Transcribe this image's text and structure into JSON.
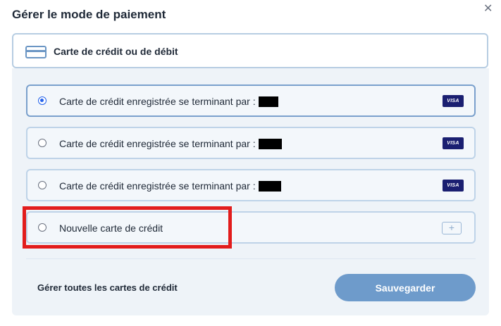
{
  "dialog": {
    "title": "Gérer le mode de paiement",
    "close_icon": "close-icon"
  },
  "method": {
    "icon": "credit-card-icon",
    "label": "Carte de crédit ou de débit"
  },
  "options": [
    {
      "label": "Carte de crédit enregistrée se terminant par :",
      "selected": true,
      "brand": "VISA"
    },
    {
      "label": "Carte de crédit enregistrée se terminant par :",
      "selected": false,
      "brand": "VISA"
    },
    {
      "label": "Carte de crédit enregistrée se terminant par :",
      "selected": false,
      "brand": "VISA"
    },
    {
      "label": "Nouvelle carte de crédit",
      "selected": false,
      "icon": "plus-icon"
    }
  ],
  "footer": {
    "manage_label": "Gérer toutes les cartes de crédit",
    "save_label": "Sauvegarder"
  },
  "colors": {
    "accent": "#6e9bcb",
    "highlight": "#e21c1c",
    "visa": "#1a1f71"
  }
}
